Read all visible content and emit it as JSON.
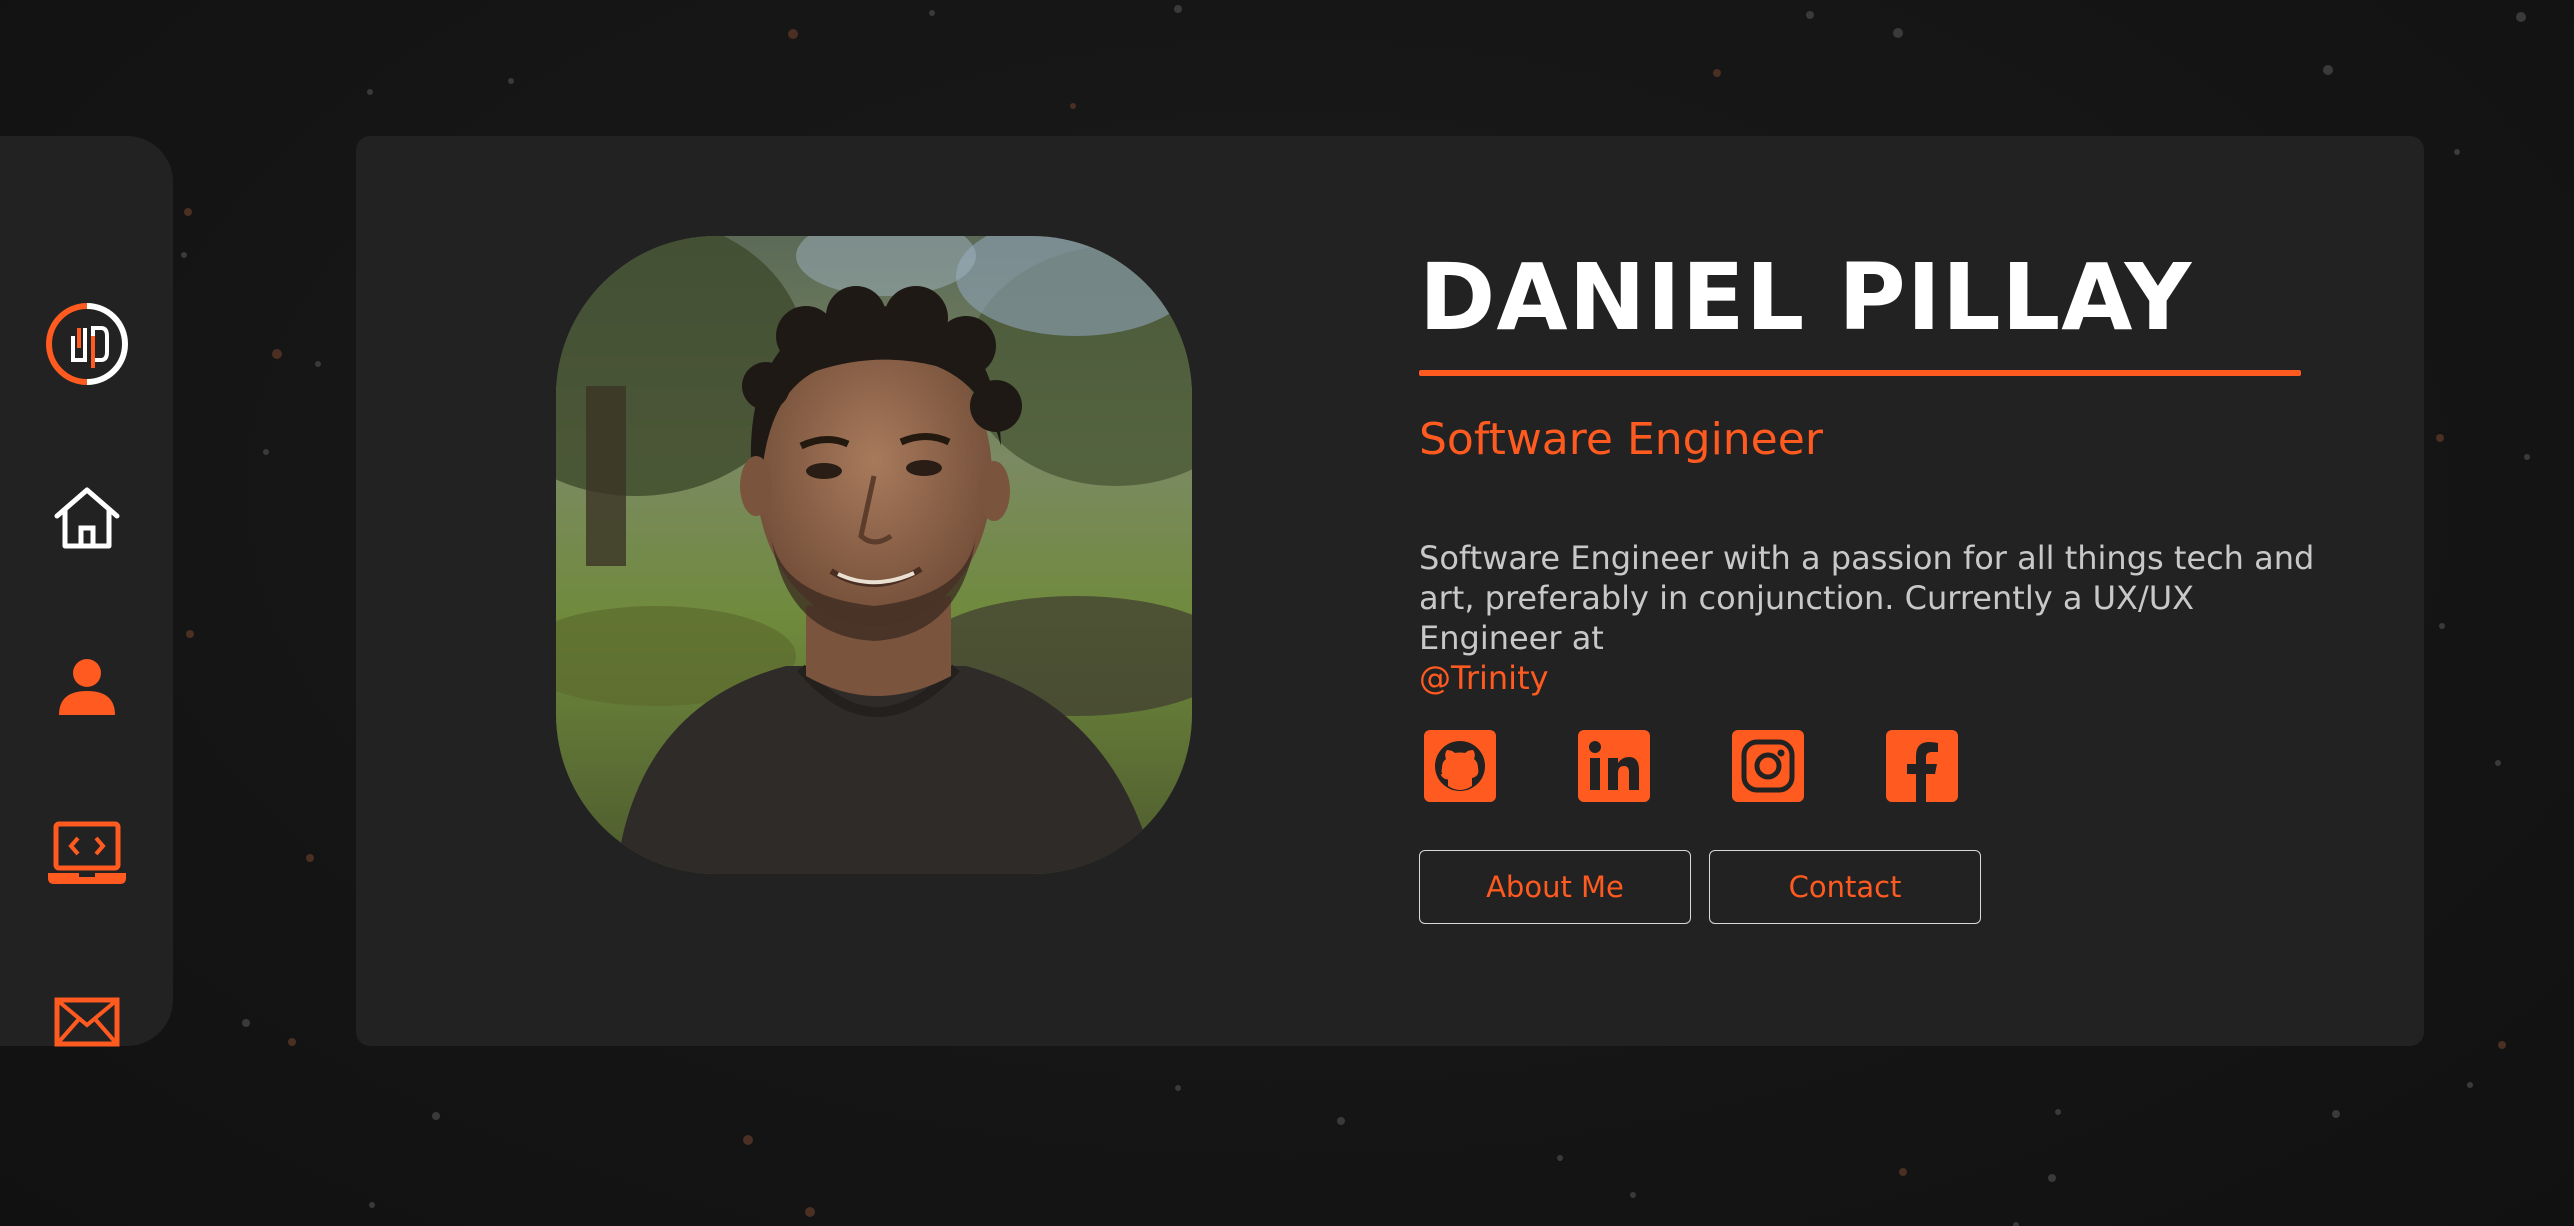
{
  "profile": {
    "name": "DANIEL PILLAY",
    "role": "Software Engineer",
    "bio_text": "Software Engineer with a passion for all things tech and art, preferably in conjunction. Currently a UX/UX Engineer at",
    "bio_handle": "@Trinity"
  },
  "sidebar": {
    "items": [
      {
        "icon": "logo-icon",
        "active": false
      },
      {
        "icon": "home-icon",
        "active": false
      },
      {
        "icon": "user-icon",
        "active": true
      },
      {
        "icon": "laptop-code-icon",
        "active": true
      },
      {
        "icon": "mail-icon",
        "active": true
      }
    ]
  },
  "socials": [
    {
      "icon": "github-icon"
    },
    {
      "icon": "linkedin-icon"
    },
    {
      "icon": "instagram-icon"
    },
    {
      "icon": "facebook-icon"
    }
  ],
  "actions": {
    "about_label": "About Me",
    "contact_label": "Contact"
  },
  "colors": {
    "accent": "#ff5a1f",
    "background": "#141414",
    "card": "#222222",
    "text": "#ffffff",
    "muted_text": "#c8c8c8"
  }
}
